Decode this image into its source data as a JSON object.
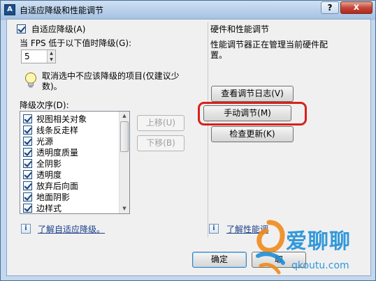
{
  "window": {
    "title": "自适应降级和性能调节",
    "app_icon": "A",
    "help_label": "?",
    "close_label": "x"
  },
  "left": {
    "adaptive_checkbox_label": "自适应降级(A)",
    "fps_label": "当 FPS 低于以下值时降级(G):",
    "fps_value": "5",
    "tip_text_line1": "取消选中不应该降级的项目(仅建议少",
    "tip_text_line2": "数)。",
    "order_label": "降级次序(D):",
    "order_items": [
      {
        "label": "视图相关对象",
        "checked": true
      },
      {
        "label": "线条反走样",
        "checked": true
      },
      {
        "label": "光源",
        "checked": true
      },
      {
        "label": "透明度质量",
        "checked": true
      },
      {
        "label": "全阴影",
        "checked": true
      },
      {
        "label": "透明度",
        "checked": true
      },
      {
        "label": "放弃后向面",
        "checked": true
      },
      {
        "label": "地面阴影",
        "checked": true
      },
      {
        "label": "边样式",
        "checked": true
      }
    ],
    "move_up_label": "上移(U)",
    "move_down_label": "下移(B)",
    "learn_link": "了解自适应降级。"
  },
  "right": {
    "group_title": "硬件和性能调节",
    "status_line1": "性能调节器正在管理当前硬件配",
    "status_line2": "置。",
    "view_log_label": "查看调节日志(V)",
    "manual_tune_label": "手动调节(M)",
    "check_updates_label": "检查更新(K)",
    "learn_link": "了解性能调",
    "highlight_color": "#d8211c"
  },
  "footer": {
    "ok_label": "确定",
    "cancel_label": "取"
  },
  "watermark": {
    "big": "爱聊聊",
    "small": "qkoutu.com"
  }
}
